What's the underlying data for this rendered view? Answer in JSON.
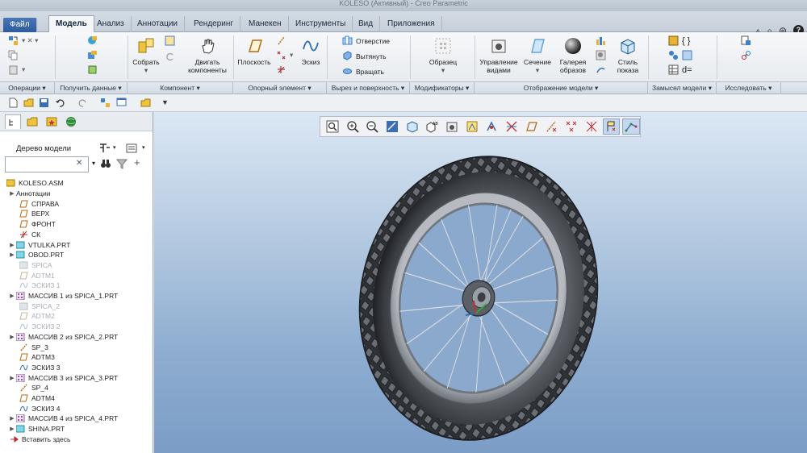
{
  "window": {
    "title": "KOLESO (Активный) - Creo Parametric"
  },
  "tabs": [
    "Файл",
    "Модель",
    "Анализ",
    "Аннотации",
    "Рендеринг",
    "Манекен",
    "Инструменты",
    "Вид",
    "Приложения"
  ],
  "active_tab": "Модель",
  "ribbon": {
    "assemble": "Собрать",
    "drag_components_1": "Двигать",
    "drag_components_2": "компоненты",
    "plane": "Плоскость",
    "sketch": "Эскиз",
    "hole": "Отверстие",
    "extrude": "Вытянуть",
    "revolve": "Вращать",
    "pattern": "Образец",
    "manage_views_1": "Управление",
    "manage_views_2": "видами",
    "section": "Сечение",
    "appearance_gallery_1": "Галерея",
    "appearance_gallery_2": "образов",
    "display_style_1": "Стиль",
    "display_style_2": "показа",
    "relations": "d="
  },
  "groups": {
    "operations": "Операции ▾",
    "get_data": "Получить данные ▾",
    "component": "Компонент ▾",
    "datum": "Опорный элемент ▾",
    "cut_surface": "Вырез и поверхность ▾",
    "modifiers": "Модификаторы ▾",
    "model_display": "Отображение модели ▾",
    "model_intent": "Замысел модели ▾",
    "investigate": "Исследовать ▾"
  },
  "left_panel": {
    "tree_title": "Дерево модели",
    "items": [
      {
        "label": "KOLESO.ASM",
        "icon": "assembly-icon",
        "expand": "",
        "indent": 0,
        "grey": false
      },
      {
        "label": "Аннотации",
        "icon": "",
        "expand": "▶",
        "indent": 1,
        "grey": false
      },
      {
        "label": "СПРАВА",
        "icon": "datum-plane-icon",
        "expand": "",
        "indent": 2,
        "grey": false
      },
      {
        "label": "ВЕРХ",
        "icon": "datum-plane-icon",
        "expand": "",
        "indent": 2,
        "grey": false
      },
      {
        "label": "ФРОНТ",
        "icon": "datum-plane-icon",
        "expand": "",
        "indent": 2,
        "grey": false
      },
      {
        "label": "СК",
        "icon": "csys-icon",
        "expand": "",
        "indent": 2,
        "grey": false
      },
      {
        "label": "VTULKA.PRT",
        "icon": "part-icon",
        "expand": "▶",
        "indent": 1,
        "grey": false
      },
      {
        "label": "OBOD.PRT",
        "icon": "part-icon",
        "expand": "▶",
        "indent": 1,
        "grey": false
      },
      {
        "label": "SPICA",
        "icon": "part-icon-grey",
        "expand": "",
        "indent": 2,
        "grey": true
      },
      {
        "label": "ADTM1",
        "icon": "datum-plane-icon-grey",
        "expand": "",
        "indent": 2,
        "grey": true
      },
      {
        "label": "ЭСКИЗ 1",
        "icon": "sketch-icon-grey",
        "expand": "",
        "indent": 2,
        "grey": true
      },
      {
        "label": "МАССИВ 1 из SPICA_1.PRT",
        "icon": "pattern-icon",
        "expand": "▶",
        "indent": 1,
        "grey": false
      },
      {
        "label": "SPICA_2",
        "icon": "part-icon-grey",
        "expand": "",
        "indent": 2,
        "grey": true
      },
      {
        "label": "ADTM2",
        "icon": "datum-plane-icon-grey",
        "expand": "",
        "indent": 2,
        "grey": true
      },
      {
        "label": "ЭСКИЗ 2",
        "icon": "sketch-icon-grey",
        "expand": "",
        "indent": 2,
        "grey": true
      },
      {
        "label": "МАССИВ 2 из SPICA_2.PRT",
        "icon": "pattern-icon",
        "expand": "▶",
        "indent": 1,
        "grey": false
      },
      {
        "label": "SP_3",
        "icon": "datum-axis-icon",
        "expand": "",
        "indent": 2,
        "grey": false
      },
      {
        "label": "ADTM3",
        "icon": "datum-plane-icon",
        "expand": "",
        "indent": 2,
        "grey": false
      },
      {
        "label": "ЭСКИЗ 3",
        "icon": "sketch-icon",
        "expand": "",
        "indent": 2,
        "grey": false
      },
      {
        "label": "МАССИВ 3 из SPICA_3.PRT",
        "icon": "pattern-icon",
        "expand": "▶",
        "indent": 1,
        "grey": false
      },
      {
        "label": "SP_4",
        "icon": "datum-axis-icon",
        "expand": "",
        "indent": 2,
        "grey": false
      },
      {
        "label": "ADTM4",
        "icon": "datum-plane-icon",
        "expand": "",
        "indent": 2,
        "grey": false
      },
      {
        "label": "ЭСКИЗ 4",
        "icon": "sketch-icon",
        "expand": "",
        "indent": 2,
        "grey": false
      },
      {
        "label": "МАССИВ 4 из SPICA_4.PRT",
        "icon": "pattern-icon",
        "expand": "▶",
        "indent": 1,
        "grey": false
      },
      {
        "label": "SHINA.PRT",
        "icon": "part-icon",
        "expand": "▶",
        "indent": 1,
        "grey": false
      },
      {
        "label": "Вставить здесь",
        "icon": "insert-here-arrow-icon",
        "expand": "",
        "indent": 2,
        "grey": false
      }
    ]
  },
  "colors": {
    "accent": "#2d5b9b",
    "viewport_top": "#dbe7f4",
    "viewport_bottom": "#7b9dc6",
    "tire": "#3a3d42",
    "rim": "#8d9299"
  }
}
